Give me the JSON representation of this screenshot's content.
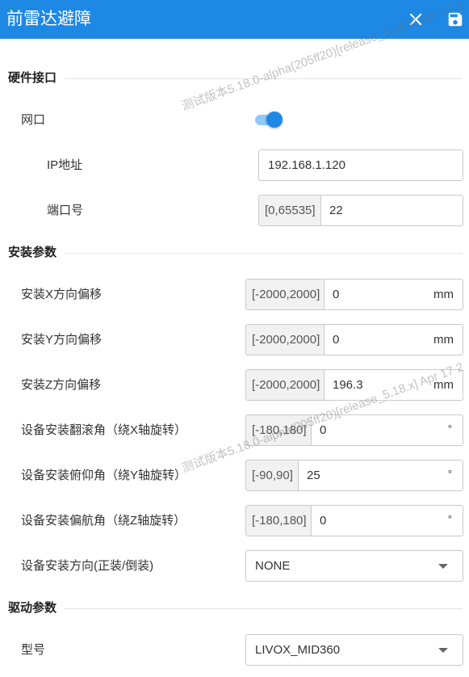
{
  "header": {
    "title": "前雷达避障"
  },
  "icons": {
    "close": "close-icon",
    "save": "save-icon",
    "dropdown": "triangle-down-icon"
  },
  "colors": {
    "accent": "#1E88E5",
    "toggle_track": "#90CAF9"
  },
  "watermark": {
    "text": "测试版本5.18.0-alpha(205ff20)[release_5.18.x] Apr 17 2"
  },
  "hardware": {
    "title": "硬件接口",
    "network": {
      "label": "网口",
      "enabled": true
    },
    "ip": {
      "label": "IP地址",
      "value": "192.168.1.120"
    },
    "port": {
      "label": "端口号",
      "range": "[0,65535]",
      "value": "22"
    }
  },
  "install": {
    "title": "安装参数",
    "offset_x": {
      "label": "安装X方向偏移",
      "range": "[-2000,2000]",
      "value": "0",
      "unit": "mm"
    },
    "offset_y": {
      "label": "安装Y方向偏移",
      "range": "[-2000,2000]",
      "value": "0",
      "unit": "mm"
    },
    "offset_z": {
      "label": "安装Z方向偏移",
      "range": "[-2000,2000]",
      "value": "196.3",
      "unit": "mm"
    },
    "roll": {
      "label": "设备安装翻滚角（绕X轴旋转）",
      "range": "[-180,180]",
      "value": "0",
      "unit": "°"
    },
    "pitch": {
      "label": "设备安装俯仰角（绕Y轴旋转）",
      "range": "[-90,90]",
      "value": "25",
      "unit": "°"
    },
    "yaw": {
      "label": "设备安装偏航角（绕Z轴旋转）",
      "range": "[-180,180]",
      "value": "0",
      "unit": "°"
    },
    "direction": {
      "label": "设备安装方向(正装/倒装)",
      "value": "NONE"
    }
  },
  "driver": {
    "title": "驱动参数",
    "model": {
      "label": "型号",
      "value": "LIVOX_MID360"
    }
  }
}
